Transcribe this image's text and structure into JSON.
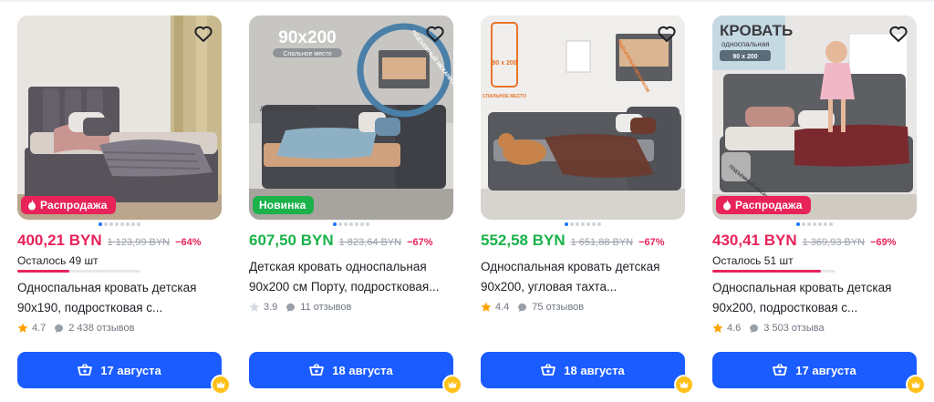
{
  "products": [
    {
      "badge": "Распродажа",
      "badge_type": "sale",
      "price": "400,21 BYN",
      "old_price": "1 123,99 BYN",
      "discount": "−64%",
      "stock": "Осталось 49 шт",
      "stock_level": 0.42,
      "title": "Односпальная кровать детская 90х190, подростковая с...",
      "rating": "4.7",
      "reviews": "2 438 отзывов",
      "delivery": "17 августа",
      "active_dot": 1,
      "photo_text": []
    },
    {
      "badge": "Новинка",
      "badge_type": "new",
      "price": "607,50 BYN",
      "old_price": "1 823,64 BYN",
      "discount": "−67%",
      "stock": "",
      "stock_level": 0,
      "title": "Детская кровать односпальная 90х200 см Порту, подростковая...",
      "rating": "3.9",
      "reviews": "11 отзывов",
      "delivery": "18 августа",
      "active_dot": 0,
      "photo_text": [
        "90x200",
        "Спальное место",
        "Декоративная стежка",
        "ПОДЪЕМНЫЙ МЕХАНИЗМ"
      ]
    },
    {
      "badge": "",
      "badge_type": "none",
      "price": "552,58 BYN",
      "old_price": "1 651,88 BYN",
      "discount": "−67%",
      "stock": "",
      "stock_level": 0,
      "title": "Односпальная кровать детская 90х200, угловая тахта...",
      "rating": "4.4",
      "reviews": "75 отзывов",
      "delivery": "18 августа",
      "active_dot": 0,
      "photo_text": [
        "90 x 200",
        "СПАЛЬНОЕ МЕСТО",
        "ПОДЪЕМНЫЙ МЕХАНИЗМ"
      ]
    },
    {
      "badge": "Распродажа",
      "badge_type": "sale",
      "price": "430,41 BYN",
      "old_price": "1 369,93 BYN",
      "discount": "−69%",
      "stock": "Осталось 51 шт",
      "stock_level": 0.88,
      "title": "Односпальная кровать детская 90х200, подростковая с...",
      "rating": "4.6",
      "reviews": "3 503 отзыва",
      "delivery": "17 августа",
      "active_dot": 0,
      "photo_text": [
        "КРОВАТЬ",
        "односпальная",
        "90 x 200",
        "ПОДЪЕМНЫЙ МЕХАНИЗМ"
      ]
    }
  ],
  "colors": {
    "sale": "#e8235a",
    "new": "#1bb24a",
    "button": "#1a5cff",
    "crown": "#ffc11a"
  },
  "icons": {
    "favorite": "heart-icon",
    "cart": "cart-icon",
    "star": "star-icon",
    "reviews": "chat-bubble-icon",
    "badge": "flame-icon",
    "premium": "crown-icon"
  }
}
